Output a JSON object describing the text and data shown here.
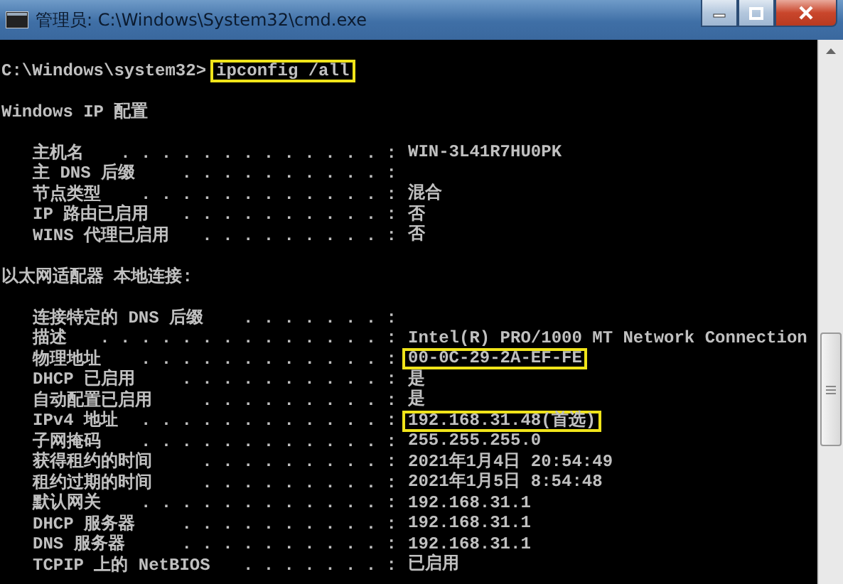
{
  "window": {
    "title": "管理员: C:\\Windows\\System32\\cmd.exe"
  },
  "lines": [
    {
      "kind": "blank"
    },
    {
      "kind": "prompt",
      "prompt": "C:\\Windows\\system32>",
      "command": "ipconfig /all",
      "highlighted": true
    },
    {
      "kind": "blank"
    },
    {
      "kind": "heading",
      "text": "Windows IP 配置"
    },
    {
      "kind": "blank"
    },
    {
      "kind": "entry",
      "label": "主机名",
      "leader": ". . . . . . . . . . . . . :",
      "value": "WIN-3L41R7HU0PK",
      "highlighted": false
    },
    {
      "kind": "entry",
      "label": "主 DNS 后缀",
      "leader": ". . . . . . . . . . :",
      "highlighted": false
    },
    {
      "kind": "entry",
      "label": "节点类型",
      "leader": ". . . . . . . . . . . . :",
      "value": "混合",
      "highlighted": false
    },
    {
      "kind": "entry",
      "label": "IP 路由已启用",
      "leader": ". . . . . . . . . . :",
      "value": "否",
      "highlighted": false
    },
    {
      "kind": "entry",
      "label": "WINS 代理已启用",
      "leader": ". . . . . . . . . :",
      "value": "否",
      "highlighted": false
    },
    {
      "kind": "blank"
    },
    {
      "kind": "heading",
      "text": "以太网适配器 本地连接:"
    },
    {
      "kind": "blank"
    },
    {
      "kind": "entry",
      "label": "连接特定的 DNS 后缀",
      "leader": ". . . . . . . :",
      "highlighted": false
    },
    {
      "kind": "entry",
      "label": "描述",
      "leader": ". . . . . . . . . . . . . . :",
      "value": "Intel(R) PRO/1000 MT Network Connection",
      "highlighted": false
    },
    {
      "kind": "entry",
      "label": "物理地址",
      "leader": ". . . . . . . . . . . . :",
      "value": "00-0C-29-2A-EF-FE",
      "highlighted": true
    },
    {
      "kind": "entry",
      "label": "DHCP 已启用",
      "leader": ". . . . . . . . . . :",
      "value": "是",
      "highlighted": false
    },
    {
      "kind": "entry",
      "label": "自动配置已启用",
      "leader": ". . . . . . . . . :",
      "value": "是",
      "highlighted": false
    },
    {
      "kind": "entry",
      "label": "IPv4 地址",
      "leader": ". . . . . . . . . . . . :",
      "value": "192.168.31.48(首选)",
      "highlighted": true
    },
    {
      "kind": "entry",
      "label": "子网掩码",
      "leader": ". . . . . . . . . . . . :",
      "value": "255.255.255.0",
      "highlighted": false
    },
    {
      "kind": "entry",
      "label": "获得租约的时间",
      "leader": ". . . . . . . . . :",
      "value": "2021年1月4日 20:54:49",
      "highlighted": false
    },
    {
      "kind": "entry",
      "label": "租约过期的时间",
      "leader": ". . . . . . . . . :",
      "value": "2021年1月5日 8:54:48",
      "highlighted": false
    },
    {
      "kind": "entry",
      "label": "默认网关",
      "leader": ". . . . . . . . . . . . :",
      "value": "192.168.31.1",
      "highlighted": false
    },
    {
      "kind": "entry",
      "label": "DHCP 服务器",
      "leader": ". . . . . . . . . . :",
      "value": "192.168.31.1",
      "highlighted": false
    },
    {
      "kind": "entry",
      "label": "DNS 服务器",
      "leader": ". . . . . . . . . . :",
      "value": "192.168.31.1",
      "highlighted": false
    },
    {
      "kind": "entry",
      "label": "TCPIP 上的 NetBIOS",
      "leader": ". . . . . . . :",
      "value": "已启用",
      "highlighted": false
    }
  ]
}
